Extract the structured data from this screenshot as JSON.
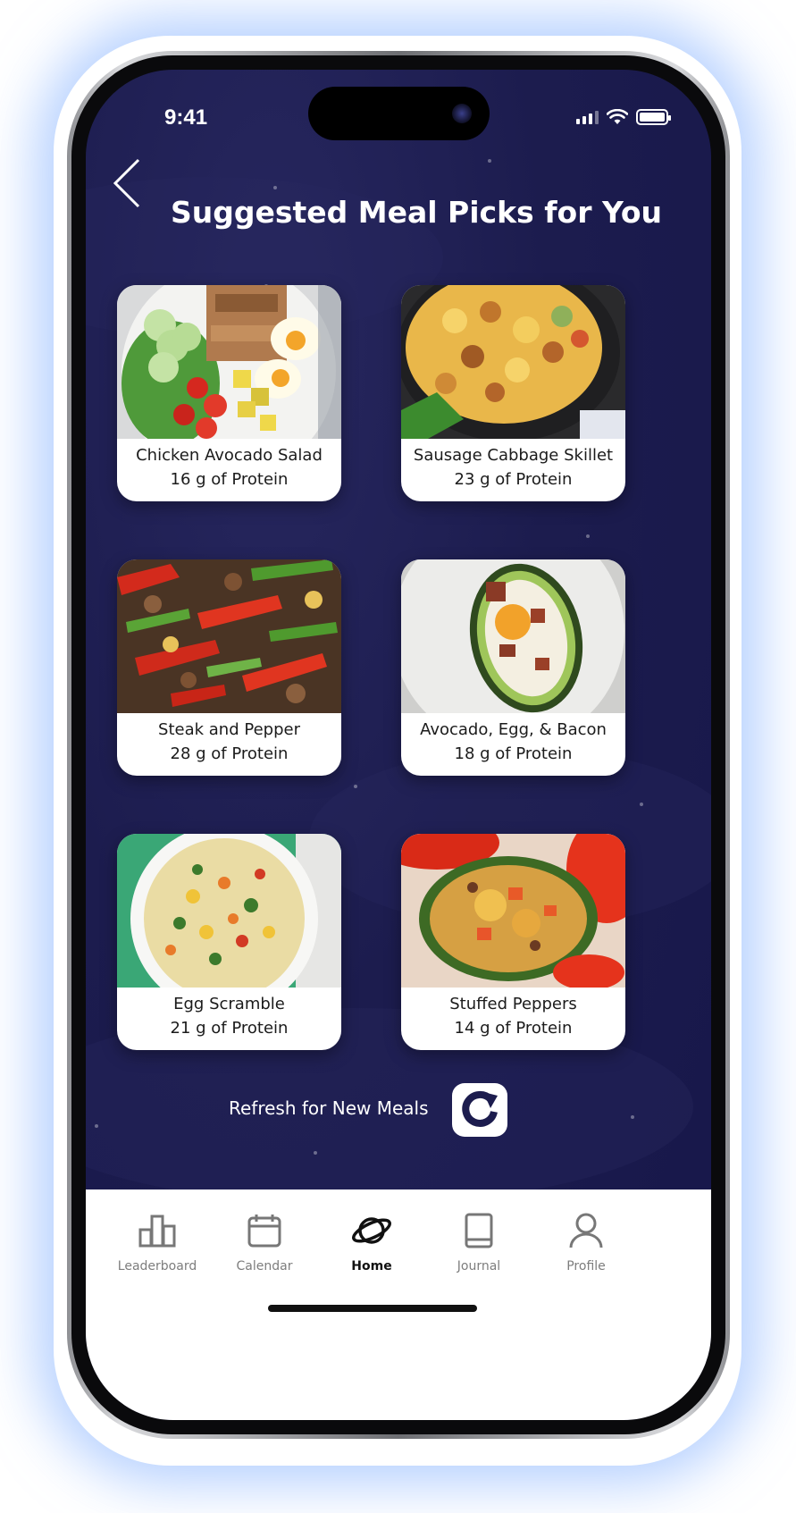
{
  "status": {
    "time": "9:41"
  },
  "header": {
    "title": "Suggested Meal Picks for You"
  },
  "meals": [
    {
      "name": "Chicken Avocado Salad",
      "protein": "16 g of Protein"
    },
    {
      "name": "Sausage Cabbage Skillet",
      "protein": "23 g of Protein"
    },
    {
      "name": "Steak and Pepper",
      "protein": "28 g of Protein"
    },
    {
      "name": "Avocado, Egg, & Bacon",
      "protein": "18 g of Protein"
    },
    {
      "name": "Egg Scramble",
      "protein": "21 g of Protein"
    },
    {
      "name": "Stuffed Peppers",
      "protein": "14 g of Protein"
    }
  ],
  "refresh": {
    "label": "Refresh for New Meals",
    "icon": "refresh-icon"
  },
  "tabs": [
    {
      "label": "Leaderboard",
      "icon": "leaderboard-icon"
    },
    {
      "label": "Calendar",
      "icon": "calendar-icon"
    },
    {
      "label": "Home",
      "icon": "planet-icon",
      "active": true
    },
    {
      "label": "Journal",
      "icon": "book-icon"
    },
    {
      "label": "Profile",
      "icon": "person-icon"
    }
  ],
  "colors": {
    "background": "#1c1c4e",
    "card": "#ffffff",
    "text_light": "#ffffff",
    "tab_inactive": "#7d7d7d",
    "tab_active": "#111111"
  }
}
